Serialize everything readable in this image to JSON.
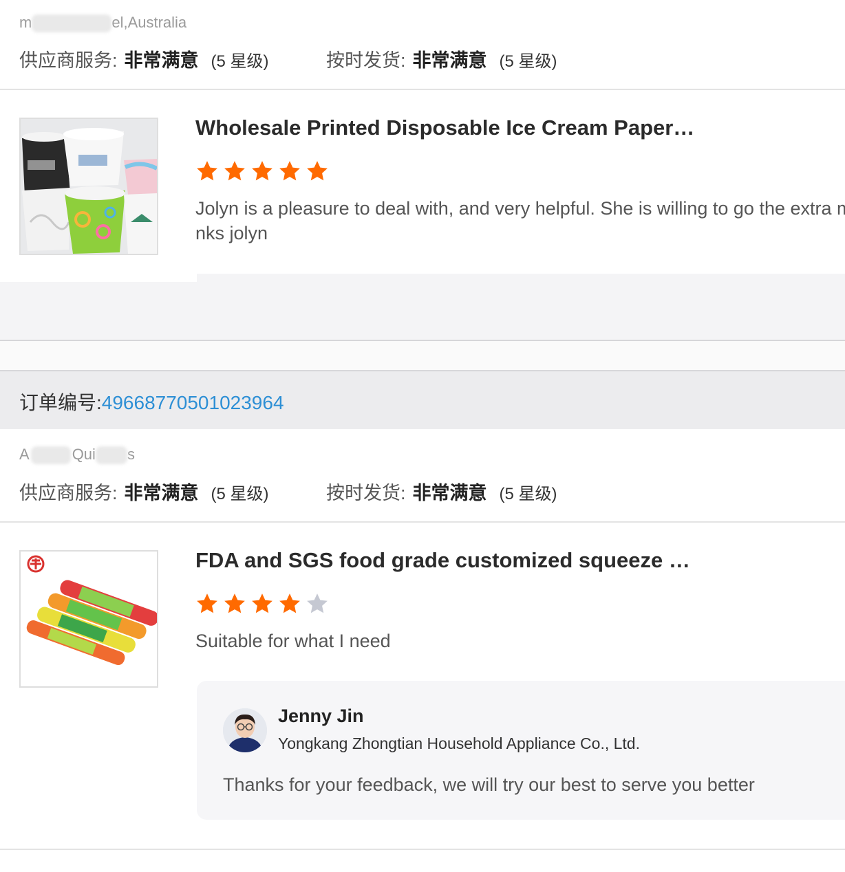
{
  "review1": {
    "buyer_prefix": "m",
    "buyer_suffix": "el,Australia",
    "supplier_service_label": "供应商服务:",
    "supplier_service_value": "非常满意",
    "supplier_service_level": "(5 星级)",
    "ontime_label": "按时发货:",
    "ontime_value": "非常满意",
    "ontime_level": "(5 星级)",
    "product_title": "Wholesale Printed Disposable Ice Cream Paper…",
    "stars_filled": 5,
    "stars_total": 5,
    "review_line1": "Jolyn is a pleasure to deal with, and very helpful. She is willing to go the extra mile",
    "review_line2": "nks jolyn"
  },
  "order": {
    "label": "订单编号:",
    "number": "49668770501023964"
  },
  "review2": {
    "buyer_prefix": "A",
    "buyer_middle": "Qui",
    "buyer_suffix": "s",
    "supplier_service_label": "供应商服务:",
    "supplier_service_value": "非常满意",
    "supplier_service_level": "(5 星级)",
    "ontime_label": "按时发货:",
    "ontime_value": "非常满意",
    "ontime_level": "(5 星级)",
    "product_title": "FDA and SGS food grade customized squeeze …",
    "stars_filled": 4,
    "stars_total": 5,
    "review_text": "Suitable for what I need",
    "reply": {
      "name": "Jenny Jin",
      "company": "Yongkang Zhongtian Household Appliance Co., Ltd.",
      "text": "Thanks for your feedback, we will try our best to serve you better"
    }
  },
  "colors": {
    "star_filled": "#ff6a00",
    "star_empty": "#c5c8d2",
    "order_number": "#2d8fd5"
  }
}
